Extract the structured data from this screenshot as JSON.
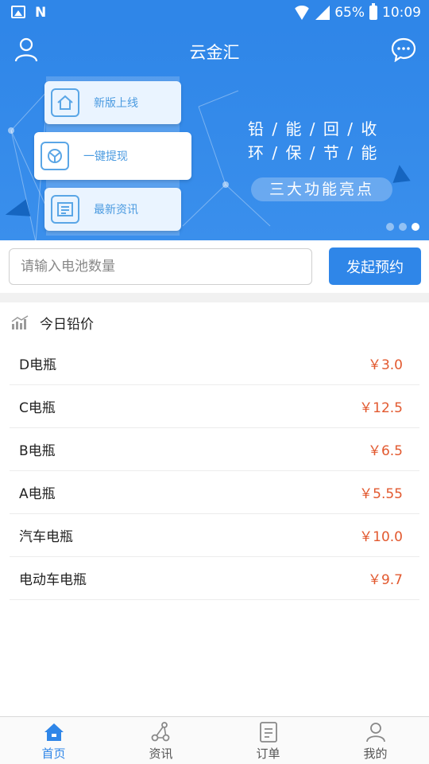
{
  "status_bar": {
    "battery": "65%",
    "time": "10:09",
    "n_icon": "N"
  },
  "header": {
    "title": "云金汇",
    "left_icon": "user-icon",
    "right_icon": "chat-icon"
  },
  "banner": {
    "cards": [
      {
        "label": "新版上线",
        "icon": "home-icon"
      },
      {
        "label": "一键提现",
        "icon": "withdraw-icon"
      },
      {
        "label": "最新资讯",
        "icon": "news-icon"
      }
    ],
    "slogan_line1": "铅 / 能 / 回 / 收",
    "slogan_line2": "环 / 保 / 节 / 能",
    "highlight": "三大功能亮点",
    "page_count": 3,
    "active_page": 3
  },
  "booking": {
    "placeholder": "请输入电池数量",
    "button_label": "发起预约"
  },
  "prices": {
    "title": "今日铅价",
    "items": [
      {
        "name": "D电瓶",
        "price": "￥3.0"
      },
      {
        "name": "C电瓶",
        "price": "￥12.5"
      },
      {
        "name": "B电瓶",
        "price": "￥6.5"
      },
      {
        "name": "A电瓶",
        "price": "￥5.55"
      },
      {
        "name": "汽车电瓶",
        "price": "￥10.0"
      },
      {
        "name": "电动车电瓶",
        "price": "￥9.7"
      }
    ]
  },
  "nav": {
    "items": [
      {
        "label": "首页",
        "icon": "home-icon",
        "active": true
      },
      {
        "label": "资讯",
        "icon": "news-icon",
        "active": false
      },
      {
        "label": "订单",
        "icon": "order-icon",
        "active": false
      },
      {
        "label": "我的",
        "icon": "profile-icon",
        "active": false
      }
    ]
  },
  "colors": {
    "primary": "#2f86e8",
    "price": "#e2592f",
    "divider": "#ececec"
  }
}
